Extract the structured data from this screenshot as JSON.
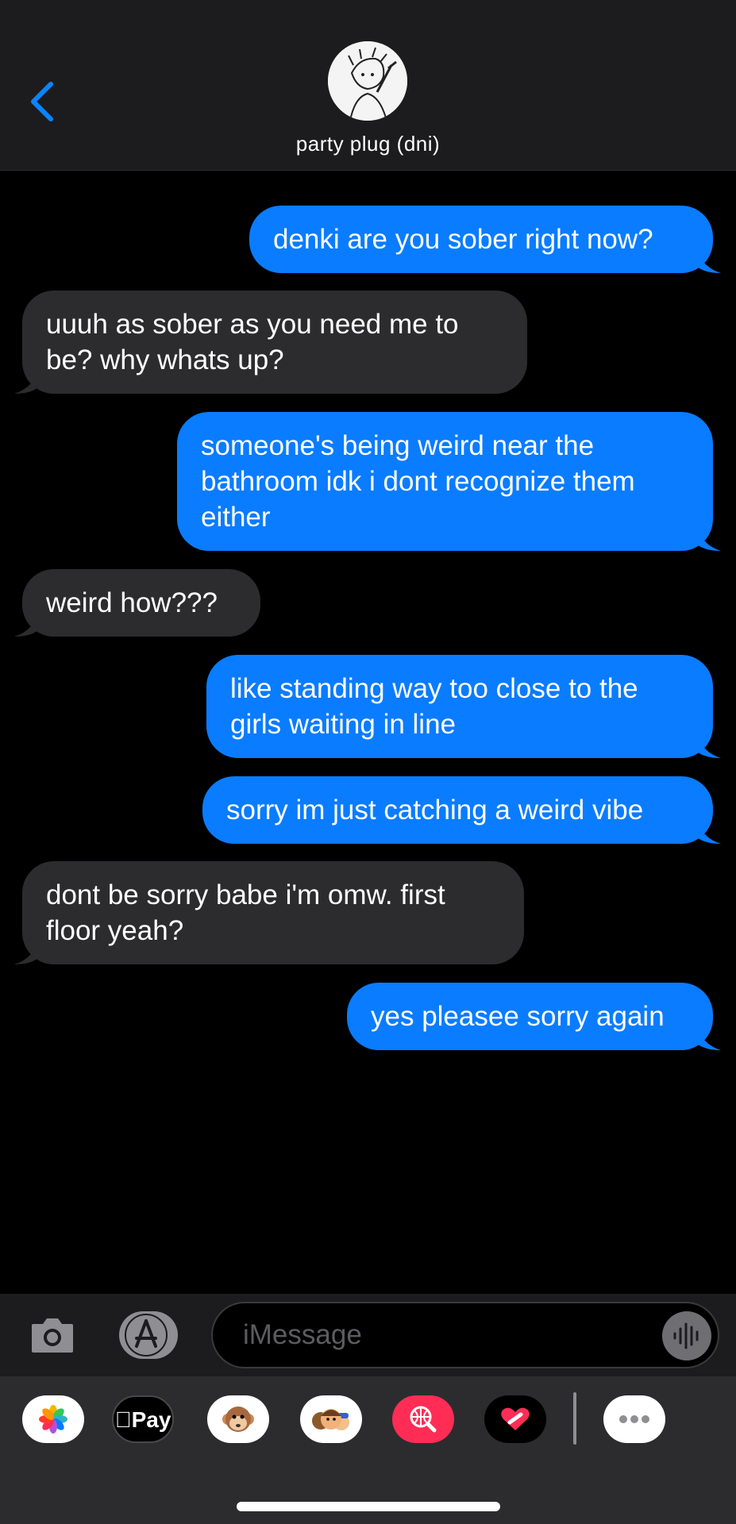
{
  "header": {
    "contact_name": "party plug (dni)"
  },
  "messages": [
    {
      "from": "me",
      "text": "denki are you sober right now?"
    },
    {
      "from": "them",
      "text": "uuuh as sober as you need me to be? why whats up?"
    },
    {
      "from": "me",
      "text": "someone's being weird near the bathroom idk i dont recognize them either"
    },
    {
      "from": "them",
      "text": "weird how???"
    },
    {
      "from": "me",
      "text": "like standing way too close to the girls waiting in line"
    },
    {
      "from": "me",
      "text": "sorry im just catching a weird vibe"
    },
    {
      "from": "them",
      "text": "dont be sorry babe i'm omw. first floor yeah?"
    },
    {
      "from": "me",
      "text": "yes pleasee sorry again"
    }
  ],
  "composer": {
    "placeholder": "iMessage"
  },
  "app_drawer": {
    "apple_pay_label": "Pay",
    "apps": [
      "photos-icon",
      "apple-pay-icon",
      "animoji-icon",
      "memoji-icon",
      "web-search-icon",
      "digital-touch-icon",
      "more-icon"
    ]
  },
  "colors": {
    "sent_bubble": "#0a7cff",
    "received_bubble": "#2c2c2e",
    "accent": "#0a84ff",
    "background": "#000000"
  }
}
